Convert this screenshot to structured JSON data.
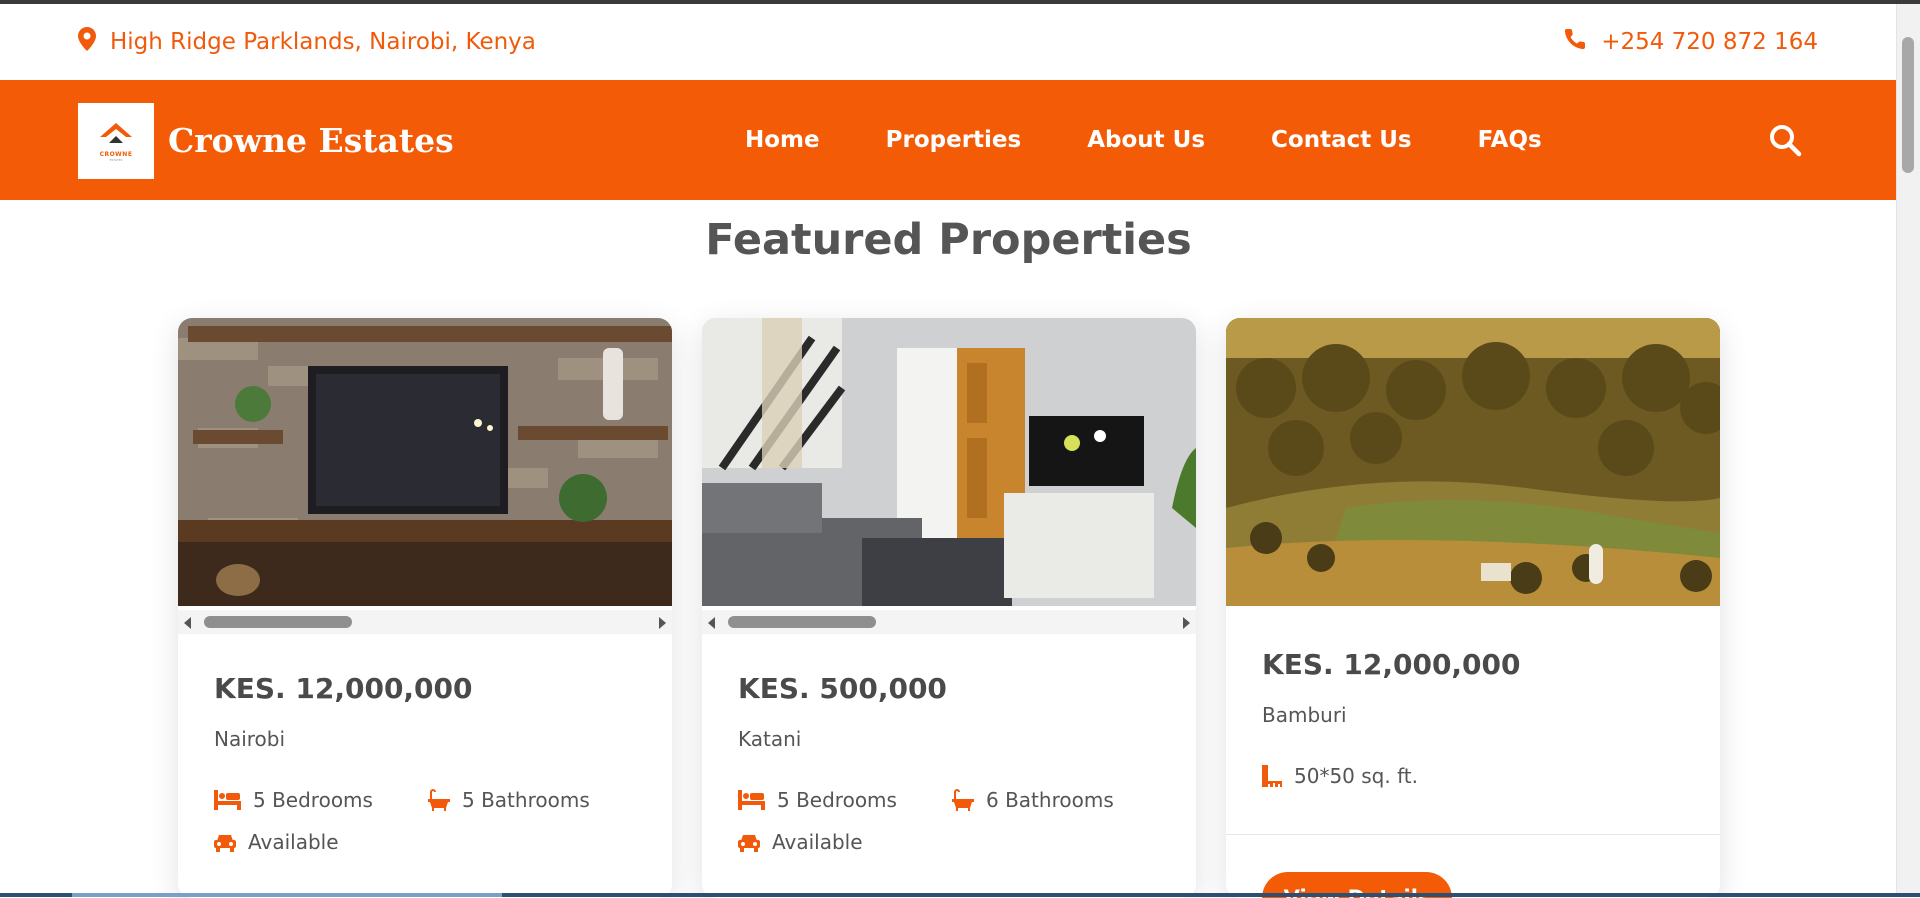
{
  "topbar": {
    "address": "High Ridge Parklands, Nairobi, Kenya",
    "phone": "+254 720 872 164",
    "address_icon": "map-pin-icon",
    "phone_icon": "phone-icon"
  },
  "header": {
    "logo_word": "CROWNE",
    "logo_sub": "ESTATES",
    "brand": "Crowne Estates",
    "nav": [
      "Home",
      "Properties",
      "About Us",
      "Contact Us",
      "FAQs"
    ],
    "search_icon": "search-icon"
  },
  "section": {
    "title": "Featured Properties"
  },
  "properties": [
    {
      "price": "KES. 12,000,000",
      "location": "Nairobi",
      "bedrooms": "5 Bedrooms",
      "bathrooms": "5 Bathrooms",
      "status": "Available"
    },
    {
      "price": "KES. 500,000",
      "location": "Katani",
      "bedrooms": "5 Bedrooms",
      "bathrooms": "6 Bathrooms",
      "status": "Available"
    },
    {
      "price": "KES. 12,000,000",
      "location": "Bamburi",
      "size": "50*50 sq. ft.",
      "button": "View Details"
    }
  ],
  "colors": {
    "accent": "#f45b07",
    "text": "#4a4a4a"
  }
}
